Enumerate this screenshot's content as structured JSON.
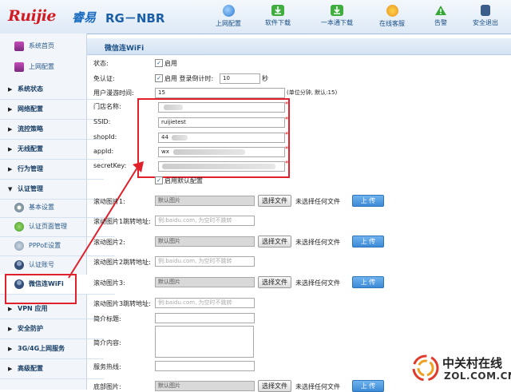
{
  "header": {
    "logo": "Ruijie",
    "logo_cn": "睿易",
    "model": "RG－NBR",
    "nav": [
      {
        "label": "上网配置",
        "icon": "globe-icon",
        "color": "#2e7bd0"
      },
      {
        "label": "软件下载",
        "icon": "download-icon",
        "color": "#3fae3f"
      },
      {
        "label": "一本通下载",
        "icon": "download-icon",
        "color": "#3fae3f"
      },
      {
        "label": "在线客服",
        "icon": "support-icon",
        "color": "#e8921e"
      },
      {
        "label": "告警",
        "icon": "warning-icon",
        "color": "#38a838"
      },
      {
        "label": "安全退出",
        "icon": "logout-icon",
        "color": "#3a5d8a"
      }
    ]
  },
  "sidebar": {
    "top_items": [
      {
        "label": "系统首页",
        "icon": "monitor-icon"
      },
      {
        "label": "上网配置",
        "icon": "monitor-icon"
      }
    ],
    "sections": [
      "系统状态",
      "网络配置",
      "流控策略",
      "无线配置",
      "行为管理",
      "认证管理"
    ],
    "auth_items": [
      {
        "label": "基本设置",
        "icon": "gear-icon"
      },
      {
        "label": "认证页面管理",
        "icon": "page-icon"
      },
      {
        "label": "PPPoE设置",
        "icon": "pppoe-icon"
      },
      {
        "label": "认证账号",
        "icon": "user-icon"
      },
      {
        "label": "微信连WiFi",
        "icon": "user-icon"
      }
    ],
    "bottom_sections": [
      "VPN 应用",
      "安全防护",
      "3G/4G上网服务",
      "高级配置"
    ]
  },
  "main": {
    "title": "微信连WiFi",
    "status_label": "状态:",
    "status_enable": "启用",
    "free_auth_label": "免认证:",
    "free_auth_enable": "启用",
    "countdown_label": "登录倒计时:",
    "countdown_value": "10",
    "countdown_unit": "秒",
    "idle_label": "用户漫游时间:",
    "idle_value": "15",
    "idle_hint": "(单位分钟, 默认:15)",
    "store_label": "门店名称:",
    "ssid_label": "SSID:",
    "ssid_value": "ruijietest",
    "shop_label": "shopId:",
    "shop_value": "44",
    "app_label": "appId:",
    "app_value": "wx",
    "secret_label": "secretKey:",
    "default_cfg": "启用默认配置",
    "img_default": "默认图片",
    "choose_file": "选择文件",
    "no_file": "未选择任何文件",
    "upload": "上 传",
    "url_placeholder": "例:baidu.com, 为空时不跳转",
    "scroll1": "滚动图片1:",
    "scroll1_url": "滚动图片1跳转地址:",
    "scroll2": "滚动图片2:",
    "scroll2_url": "滚动图片2跳转地址:",
    "scroll3": "滚动图片3:",
    "scroll3_url": "滚动图片3跳转地址:",
    "intro_title": "简介标题:",
    "intro_content": "简介内容:",
    "hotline": "服务热线:",
    "bottom_img": "底部图片:"
  },
  "watermark": {
    "cn": "中关村在线",
    "en": "ZOL.COM.CN"
  }
}
